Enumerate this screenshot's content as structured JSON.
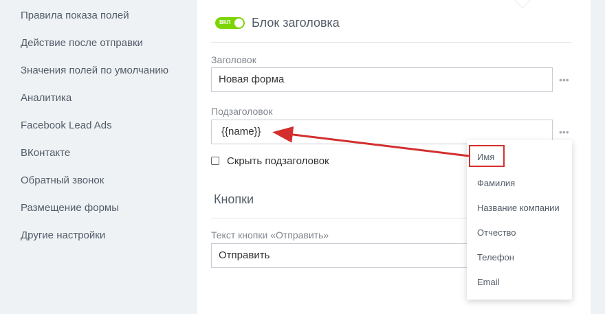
{
  "sidebar": {
    "items": [
      {
        "label": "Правила показа полей"
      },
      {
        "label": "Действие после отправки"
      },
      {
        "label": "Значения полей по умолчанию"
      },
      {
        "label": "Аналитика"
      },
      {
        "label": "Facebook Lead Ads"
      },
      {
        "label": "ВКонтакте"
      },
      {
        "label": "Обратный звонок"
      },
      {
        "label": "Размещение формы"
      },
      {
        "label": "Другие настройки"
      }
    ]
  },
  "header_block": {
    "toggle_label": "ВКЛ",
    "title": "Блок заголовка",
    "title_field_label": "Заголовок",
    "title_value": "Новая форма",
    "subtitle_field_label": "Подзаголовок",
    "subtitle_value": "{{name}}",
    "hide_subtitle_label": "Скрыть подзаголовок",
    "dots": "•••"
  },
  "buttons_block": {
    "title": "Кнопки",
    "submit_text_label": "Текст кнопки «Отправить»",
    "submit_text_value": "Отправить"
  },
  "dropdown": {
    "items": [
      {
        "label": "Имя"
      },
      {
        "label": "Фамилия"
      },
      {
        "label": "Название компании"
      },
      {
        "label": "Отчество"
      },
      {
        "label": "Телефон"
      },
      {
        "label": "Email"
      }
    ]
  },
  "colors": {
    "toggle_on": "#7bd500",
    "annotation": "#d32f2f"
  }
}
